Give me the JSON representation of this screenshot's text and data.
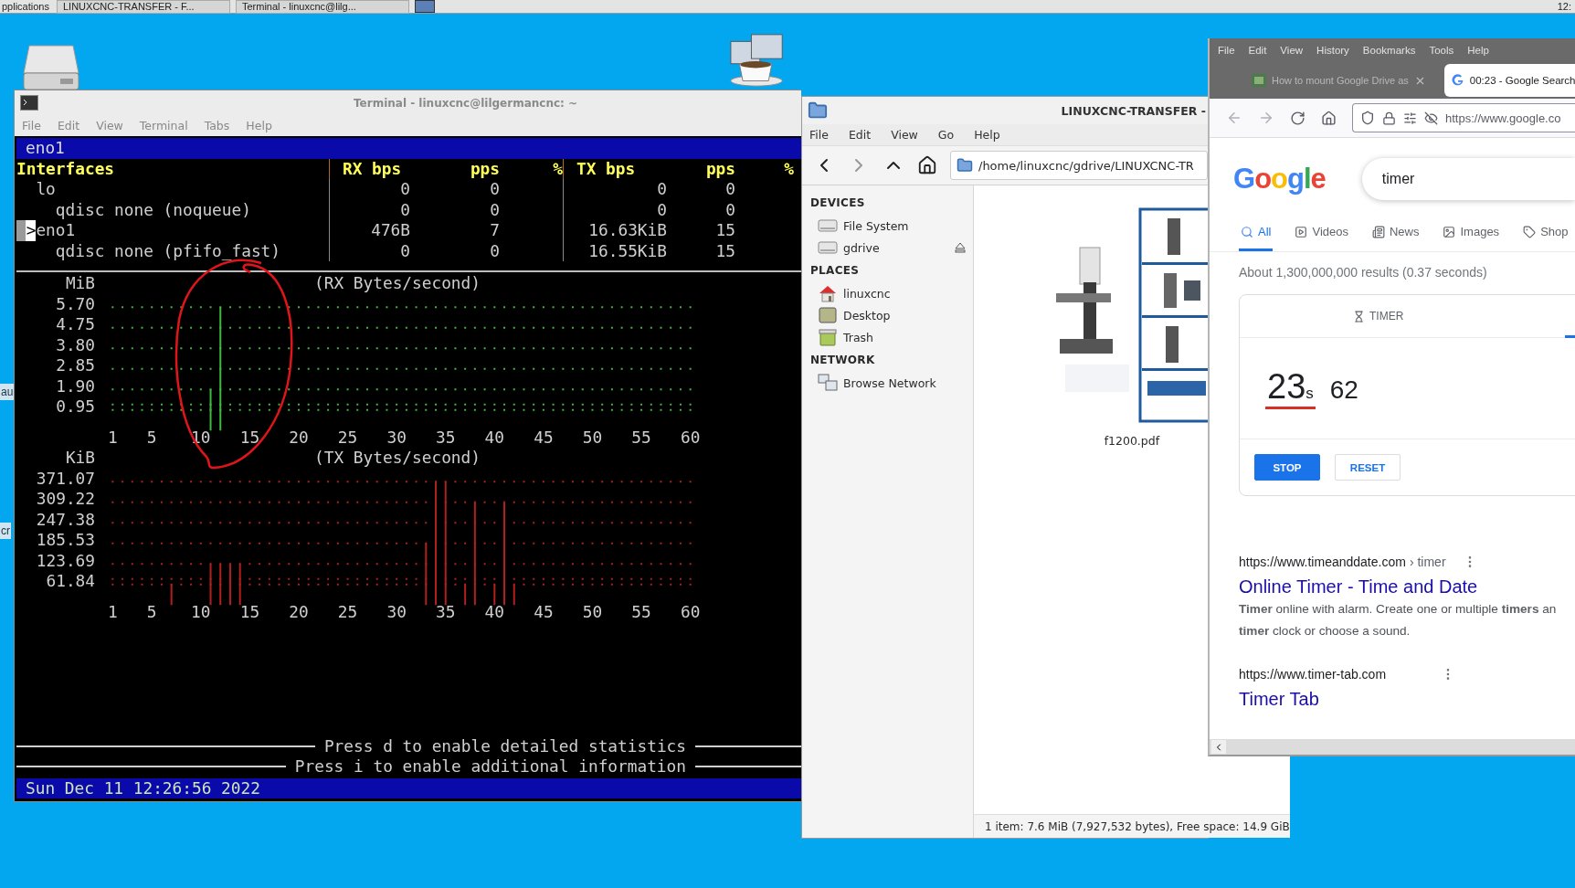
{
  "taskbar": {
    "menu": "pplications",
    "windows": [
      "LINUXCNC-TRANSFER - F...",
      "Terminal - linuxcnc@lilg..."
    ],
    "clock": "12:"
  },
  "desktop": {
    "edge_labels": [
      "au",
      "cr"
    ]
  },
  "terminal": {
    "title": "Terminal - linuxcnc@lilgermancnc: ~",
    "menu": [
      "File",
      "Edit",
      "View",
      "Terminal",
      "Tabs",
      "Help"
    ],
    "interface_bar": "eno1",
    "table": {
      "columns": [
        "Interfaces",
        "RX bps",
        "pps",
        "%",
        "TX bps",
        "pps",
        "%"
      ],
      "marker": ">",
      "rows": [
        {
          "name": "lo",
          "rx_bps": "0",
          "rx_pps": "0",
          "tx_bps": "0",
          "tx_pps": "0",
          "selected": false,
          "children": [
            {
              "name": "qdisc none (noqueue)",
              "rx_bps": "0",
              "rx_pps": "0",
              "tx_bps": "0",
              "tx_pps": "0",
              "selected": false
            }
          ]
        },
        {
          "name": "eno1",
          "rx_bps": "476B",
          "rx_pps": "7",
          "tx_bps": "16.63KiB",
          "tx_pps": "15",
          "selected": true,
          "children": [
            {
              "name": "qdisc none (pfifo_fast)",
              "rx_bps": "0",
              "rx_pps": "0",
              "tx_bps": "16.55KiB",
              "tx_pps": "15",
              "selected": false
            }
          ]
        }
      ]
    },
    "graphs": [
      {
        "chart_data": {
          "type": "bar",
          "title": "(RX Bytes/second)",
          "ylabel": "MiB",
          "xlim": [
            1,
            60
          ],
          "ylim": [
            0,
            5.7
          ],
          "grid": true,
          "x": [
            1,
            2,
            3,
            4,
            5,
            6,
            7,
            8,
            9,
            10,
            11,
            12,
            13,
            14,
            15,
            16,
            17,
            18,
            19,
            20,
            21,
            22,
            23,
            24,
            25,
            26,
            27,
            28,
            29,
            30,
            31,
            32,
            33,
            34,
            35,
            36,
            37,
            38,
            39,
            40,
            41,
            42,
            43,
            44,
            45,
            46,
            47,
            48,
            49,
            50,
            51,
            52,
            53,
            54,
            55,
            56,
            57,
            58,
            59,
            60
          ],
          "series": [
            {
              "color": "#3fb83f",
              "values": [
                0,
                0,
                0,
                0,
                0,
                0,
                0,
                0,
                0,
                0,
                1.9,
                5.7,
                0,
                0,
                0,
                0,
                0,
                0,
                0,
                0,
                0,
                0,
                0,
                0,
                0,
                0,
                0,
                0,
                0,
                0,
                0,
                0,
                0,
                0,
                0,
                0,
                0,
                0,
                0,
                0,
                0,
                0,
                0,
                0,
                0,
                0,
                0,
                0,
                0,
                0,
                0,
                0,
                0,
                0,
                0,
                0,
                0,
                0,
                0,
                0
              ]
            }
          ],
          "xticks": [
            1,
            5,
            10,
            15,
            20,
            25,
            30,
            35,
            40,
            45,
            50,
            55,
            60
          ],
          "yticks": [
            {
              "value": 0.95,
              "label": "0.95"
            },
            {
              "value": 1.9,
              "label": "1.90"
            },
            {
              "value": 2.85,
              "label": "2.85"
            },
            {
              "value": 3.8,
              "label": "3.80"
            },
            {
              "value": 4.75,
              "label": "4.75"
            },
            {
              "value": 5.7,
              "label": "5.70"
            }
          ]
        }
      },
      {
        "chart_data": {
          "type": "bar",
          "title": "(TX Bytes/second)",
          "ylabel": "KiB",
          "xlim": [
            1,
            60
          ],
          "ylim": [
            0,
            371.07
          ],
          "grid": true,
          "x": [
            1,
            2,
            3,
            4,
            5,
            6,
            7,
            8,
            9,
            10,
            11,
            12,
            13,
            14,
            15,
            16,
            17,
            18,
            19,
            20,
            21,
            22,
            23,
            24,
            25,
            26,
            27,
            28,
            29,
            30,
            31,
            32,
            33,
            34,
            35,
            36,
            37,
            38,
            39,
            40,
            41,
            42,
            43,
            44,
            45,
            46,
            47,
            48,
            49,
            50,
            51,
            52,
            53,
            54,
            55,
            56,
            57,
            58,
            59,
            60
          ],
          "series": [
            {
              "color": "#b0201e",
              "values": [
                0,
                0,
                0,
                0,
                0,
                0,
                61.84,
                0,
                0,
                0,
                123.69,
                123.69,
                123.69,
                123.69,
                0,
                0,
                0,
                0,
                0,
                0,
                0,
                0,
                0,
                0,
                0,
                0,
                0,
                0,
                0,
                0,
                0,
                0,
                185.53,
                371.07,
                371.07,
                0,
                61.84,
                309.22,
                0,
                61.84,
                309.22,
                61.84,
                0,
                0,
                0,
                0,
                0,
                0,
                0,
                0,
                0,
                0,
                0,
                0,
                0,
                0,
                0,
                0,
                0,
                0
              ]
            }
          ],
          "xticks": [
            1,
            5,
            10,
            15,
            20,
            25,
            30,
            35,
            40,
            45,
            50,
            55,
            60
          ],
          "yticks": [
            {
              "value": 61.84,
              "label": "61.84"
            },
            {
              "value": 123.69,
              "label": "123.69"
            },
            {
              "value": 185.53,
              "label": "185.53"
            },
            {
              "value": 247.38,
              "label": "247.38"
            },
            {
              "value": 309.22,
              "label": "309.22"
            },
            {
              "value": 371.07,
              "label": "371.07"
            }
          ]
        }
      }
    ],
    "hints": [
      "Press d to enable detailed statistics",
      "Press i to enable additional information"
    ],
    "status": "Sun Dec 11 12:26:56 2022"
  },
  "file_manager": {
    "title": "LINUXCNC-TRANSFER -",
    "menu": [
      "File",
      "Edit",
      "View",
      "Go",
      "Help"
    ],
    "path": "/home/linuxcnc/gdrive/LINUXCNC-TR",
    "sidebar": [
      {
        "heading": "DEVICES",
        "items": [
          {
            "label": "File System",
            "kind": "drive",
            "eject": false
          },
          {
            "label": "gdrive",
            "kind": "drive",
            "eject": true
          }
        ]
      },
      {
        "heading": "PLACES",
        "items": [
          {
            "label": "linuxcnc",
            "kind": "home",
            "eject": false
          },
          {
            "label": "Desktop",
            "kind": "desktop",
            "eject": false
          },
          {
            "label": "Trash",
            "kind": "trash",
            "eject": false
          }
        ]
      },
      {
        "heading": "NETWORK",
        "items": [
          {
            "label": "Browse Network",
            "kind": "network",
            "eject": false
          }
        ]
      }
    ],
    "files": [
      {
        "name": "f1200.pdf",
        "kind": "picture"
      }
    ],
    "status": "1 item: 7.6 MiB (7,927,532 bytes), Free space: 14.9 GiB"
  },
  "browser": {
    "menu": [
      "File",
      "Edit",
      "View",
      "History",
      "Bookmarks",
      "Tools",
      "Help"
    ],
    "tabs": [
      {
        "title": "How to mount Google Drive as",
        "selected": false
      },
      {
        "title": "00:23 - Google Search",
        "selected": true
      }
    ],
    "url": "https://www.google.co",
    "logo": "Google",
    "query": "timer",
    "search_tabs": [
      {
        "label": "All",
        "kind": "all",
        "selected": true
      },
      {
        "label": "Videos",
        "kind": "videos",
        "selected": false
      },
      {
        "label": "News",
        "kind": "news",
        "selected": false
      },
      {
        "label": "Images",
        "kind": "images",
        "selected": false
      },
      {
        "label": "Shop",
        "kind": "shopping",
        "selected": false
      }
    ],
    "result_stats": "About 1,300,000,000 results (0.37 seconds)",
    "timer": {
      "heading": "TIMER",
      "seconds": "23",
      "unit": "s",
      "hundredths": "62",
      "buttons": [
        {
          "label": "STOP",
          "kind": "primary"
        },
        {
          "label": "RESET",
          "kind": "secondary"
        }
      ]
    },
    "results": [
      {
        "url": "https://www.timeanddate.com",
        "path": "› timer",
        "title": "Online Timer - Time and Date",
        "snippet": [
          "**Timer** online with alarm. Create one or multiple **timers** an",
          "**timer** clock or choose a sound."
        ]
      },
      {
        "url": "https://www.timer-tab.com",
        "title": "Timer Tab"
      }
    ]
  }
}
